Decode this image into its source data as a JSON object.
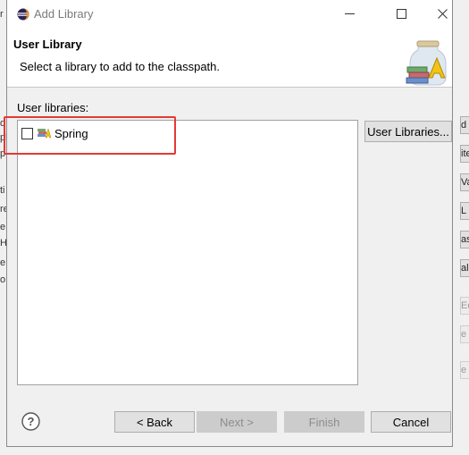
{
  "window": {
    "title": "Add Library",
    "controls": {
      "minimize": "minimize-icon",
      "maximize": "maximize-icon",
      "close": "close-icon"
    }
  },
  "header": {
    "title": "User Library",
    "description": "Select a library to add to the classpath."
  },
  "body": {
    "list_label": "User libraries:",
    "libraries": [
      {
        "label": "Spring",
        "checked": false,
        "icon": "library-icon"
      }
    ],
    "user_libraries_button": "User Libraries..."
  },
  "footer": {
    "back": "< Back",
    "next": "Next >",
    "finish": "Finish",
    "cancel": "Cancel",
    "help_icon": "help-icon"
  },
  "background": {
    "left_chars": [
      "r",
      "d",
      "pl",
      "p",
      "ti",
      "re",
      "e",
      "Hi",
      "e",
      "o"
    ],
    "right_buttons": [
      "d",
      "ite",
      "Va",
      "L",
      "as",
      "al",
      "Ed",
      "e",
      "e"
    ]
  },
  "colors": {
    "highlight": "#e53935",
    "dialog_bg": "#f0f0f0",
    "header_bg": "#ffffff"
  }
}
